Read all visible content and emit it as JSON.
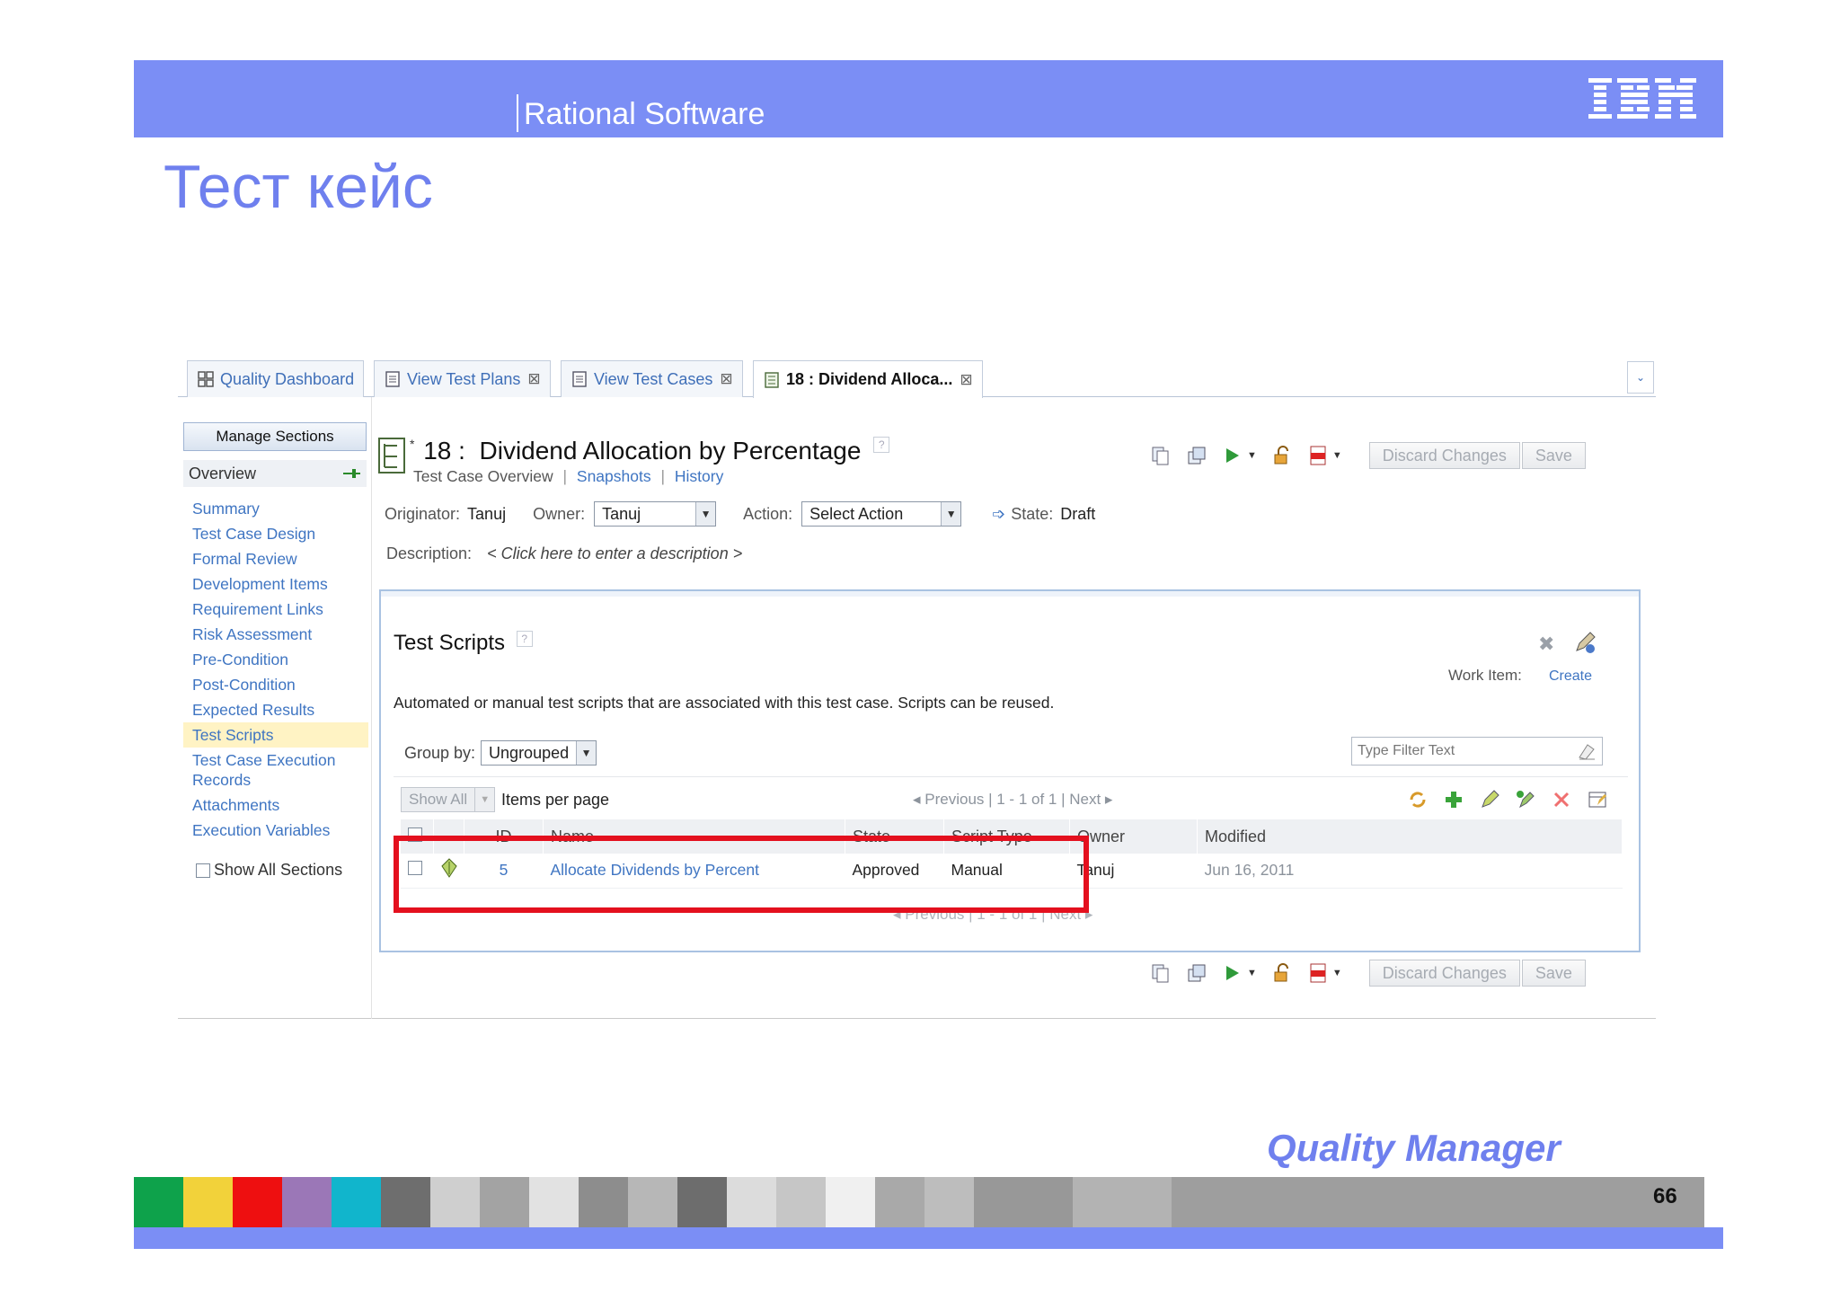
{
  "header": {
    "product": "Rational Software",
    "logo": "IBM"
  },
  "slide": {
    "title": "Тест кейс",
    "footer_brand": "Quality Manager",
    "page_number": "66"
  },
  "tabs": [
    {
      "label": "Quality Dashboard",
      "icon": "dashboard-icon",
      "closable": false
    },
    {
      "label": "View Test Plans",
      "icon": "list-icon",
      "closable": true
    },
    {
      "label": "View Test Cases",
      "icon": "list-icon",
      "closable": true
    },
    {
      "label": "18 : Dividend Alloca...",
      "icon": "testcase-icon",
      "closable": true,
      "active": true
    }
  ],
  "tab_menu": "⌄",
  "sidebar": {
    "manage_label": "Manage Sections",
    "overview_label": "Overview",
    "sections": [
      "Summary",
      "Test Case Design",
      "Formal Review",
      "Development Items",
      "Requirement Links",
      "Risk Assessment",
      "Pre-Condition",
      "Post-Condition",
      "Expected Results",
      "Test Scripts",
      "Test Case Execution Records",
      "Attachments",
      "Execution Variables"
    ],
    "selected_section": "Test Scripts",
    "show_all_label": "Show All Sections"
  },
  "test_case": {
    "id": "18 :",
    "name": "Dividend Allocation by Percentage",
    "unsaved_marker": "*",
    "help": "?",
    "links": {
      "overview": "Test Case Overview",
      "snapshots": "Snapshots",
      "history": "History",
      "separator": "|"
    },
    "originator_label": "Originator:",
    "originator": "Tanuj",
    "owner_label": "Owner:",
    "owner": "Tanuj",
    "action_label": "Action:",
    "action": "Select Action",
    "state_label": "State:",
    "state": "Draft",
    "description_label": "Description:",
    "description_placeholder": "< Click here to enter a description >"
  },
  "toolbar": {
    "discard_label": "Discard Changes",
    "save_label": "Save"
  },
  "scripts": {
    "title": "Test Scripts",
    "help": "?",
    "work_item_label": "Work Item:",
    "create_label": "Create",
    "description": "Automated or manual test scripts that are associated with this test case. Scripts can be reused.",
    "group_by_label": "Group by:",
    "group_by_value": "Ungrouped",
    "filter_placeholder": "Type Filter Text",
    "show_all_label": "Show All",
    "items_per_page_label": "Items per page",
    "pager": "◂ Previous | 1 - 1 of 1 | Next ▸",
    "columns": [
      "",
      "",
      "ID",
      "Name",
      "State",
      "Script Type",
      "Owner",
      "Modified"
    ],
    "rows": [
      {
        "id": "5",
        "name": "Allocate Dividends by Percent",
        "state": "Approved",
        "script_type": "Manual",
        "owner": "Tanuj",
        "modified": "Jun 16, 2011"
      }
    ]
  },
  "colors": {
    "header_bg": "#7b8ef5",
    "title": "#6f80ee",
    "highlight": "#e4101e",
    "link": "#3f75c2",
    "footer_strip": [
      "#0ea24b",
      "#f2d23a",
      "#ee0f10",
      "#9b77b7",
      "#11b5cc",
      "#6e6e6e",
      "#cfcfcf",
      "#a3a3a3",
      "#e2e2e2",
      "#8d8d8d",
      "#b7b7b7",
      "#6d6d6d",
      "#dcdcdc",
      "#c6c6c6",
      "#f0f0f0",
      "#a9a9a9",
      "#bdbdbd",
      "#989898",
      "#b3b3b3",
      "#9e9e9e"
    ]
  }
}
